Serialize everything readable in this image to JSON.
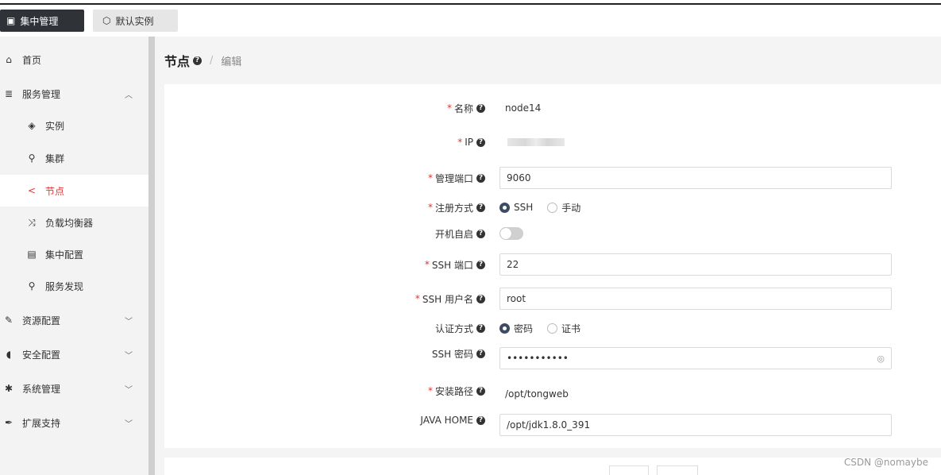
{
  "topbar": {
    "central_btn": "集中管理",
    "instance_btn": "默认实例"
  },
  "sidebar": {
    "items": [
      {
        "label": "首页",
        "icon": "home-icon"
      },
      {
        "label": "服务管理",
        "icon": "server-icon"
      },
      {
        "label": "实例",
        "icon": "cube-icon"
      },
      {
        "label": "集群",
        "icon": "sitemap-icon"
      },
      {
        "label": "节点",
        "icon": "share-icon"
      },
      {
        "label": "负载均衡器",
        "icon": "shuffle-icon"
      },
      {
        "label": "集中配置",
        "icon": "file-icon"
      },
      {
        "label": "服务发现",
        "icon": "search-icon"
      },
      {
        "label": "资源配置",
        "icon": "edit-icon"
      },
      {
        "label": "安全配置",
        "icon": "shield-icon"
      },
      {
        "label": "系统管理",
        "icon": "gear-icon"
      },
      {
        "label": "扩展支持",
        "icon": "pen-icon"
      }
    ]
  },
  "header": {
    "title": "节点",
    "sep": "/",
    "crumb": "编辑"
  },
  "form": {
    "name": {
      "label": "名称",
      "value": "node14"
    },
    "ip": {
      "label": "IP"
    },
    "mgmt_port": {
      "label": "管理端口",
      "value": "9060"
    },
    "register": {
      "label": "注册方式",
      "opt1": "SSH",
      "opt2": "手动"
    },
    "autostart": {
      "label": "开机自启"
    },
    "ssh_port": {
      "label": "SSH 端口",
      "value": "22"
    },
    "ssh_user": {
      "label": "SSH 用户名",
      "value": "root"
    },
    "auth": {
      "label": "认证方式",
      "opt1": "密码",
      "opt2": "证书"
    },
    "ssh_pwd": {
      "label": "SSH 密码",
      "value": "•••••••••••"
    },
    "install_path": {
      "label": "安装路径",
      "value": "/opt/tongweb"
    },
    "java_home": {
      "label": "JAVA HOME",
      "value": "/opt/jdk1.8.0_391"
    }
  },
  "watermark": "CSDN @nomaybe",
  "colors": {
    "accent": "#e8322f",
    "radio": "#3d4b63",
    "topbar_dark": "#2f3338"
  }
}
